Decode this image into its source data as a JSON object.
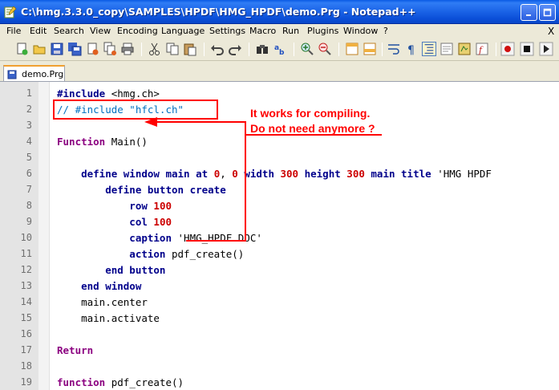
{
  "window": {
    "title": "C:\\hmg.3.3.0_copy\\SAMPLES\\HPDF\\HMG_HPDF\\demo.Prg - Notepad++"
  },
  "menu": {
    "items": [
      "File",
      "Edit",
      "Search",
      "View",
      "Encoding",
      "Language",
      "Settings",
      "Macro",
      "Run",
      "Plugins",
      "Window",
      "?"
    ],
    "close": "X"
  },
  "toolbar": {
    "icons": [
      "new-file-icon",
      "open-file-icon",
      "save-icon",
      "save-all-icon",
      "close-icon",
      "close-all-icon",
      "print-icon",
      "cut-icon",
      "copy-icon",
      "paste-icon",
      "undo-icon",
      "redo-icon",
      "find-icon",
      "replace-icon",
      "zoom-in-icon",
      "zoom-out-icon",
      "sync-v-icon",
      "sync-h-icon",
      "word-wrap-icon",
      "show-all-chars-icon",
      "indent-guide-icon",
      "udl-icon",
      "doc-map-icon",
      "function-list-icon",
      "record-macro-icon",
      "stop-macro-icon",
      "play-macro-icon"
    ]
  },
  "tab": {
    "label": "demo.Prg"
  },
  "editor": {
    "lines": [
      {
        "n": "1",
        "tokens": [
          {
            "t": "#include",
            "c": "kw"
          },
          {
            "t": " <hmg.ch>",
            "c": "plain"
          }
        ]
      },
      {
        "n": "2",
        "tokens": [
          {
            "t": "// #include \"hfcl.ch\"",
            "c": "cmt"
          }
        ]
      },
      {
        "n": "3",
        "tokens": []
      },
      {
        "n": "4",
        "tokens": [
          {
            "t": "Function",
            "c": "kw2"
          },
          {
            "t": " Main()",
            "c": "plain"
          }
        ]
      },
      {
        "n": "5",
        "tokens": []
      },
      {
        "n": "6",
        "tokens": [
          {
            "t": "    define window ",
            "c": "kw"
          },
          {
            "t": "main",
            "c": "kw"
          },
          {
            "t": " at ",
            "c": "kw"
          },
          {
            "t": "0",
            "c": "num"
          },
          {
            "t": ", ",
            "c": "plain"
          },
          {
            "t": "0",
            "c": "num"
          },
          {
            "t": " width ",
            "c": "kw"
          },
          {
            "t": "300",
            "c": "num"
          },
          {
            "t": " height ",
            "c": "kw"
          },
          {
            "t": "300",
            "c": "num"
          },
          {
            "t": " main title ",
            "c": "kw"
          },
          {
            "t": "'HMG HPDF",
            "c": "plain"
          }
        ]
      },
      {
        "n": "7",
        "tokens": [
          {
            "t": "        define button ",
            "c": "kw"
          },
          {
            "t": "create",
            "c": "kw"
          }
        ]
      },
      {
        "n": "8",
        "tokens": [
          {
            "t": "            row ",
            "c": "kw"
          },
          {
            "t": "100",
            "c": "num"
          }
        ]
      },
      {
        "n": "9",
        "tokens": [
          {
            "t": "            col ",
            "c": "kw"
          },
          {
            "t": "100",
            "c": "num"
          }
        ]
      },
      {
        "n": "10",
        "tokens": [
          {
            "t": "            caption ",
            "c": "kw"
          },
          {
            "t": "'HMG_HPDF DOC'",
            "c": "plain"
          }
        ]
      },
      {
        "n": "11",
        "tokens": [
          {
            "t": "            action ",
            "c": "kw"
          },
          {
            "t": "pdf_create()",
            "c": "plain"
          }
        ]
      },
      {
        "n": "12",
        "tokens": [
          {
            "t": "        end button",
            "c": "kw"
          }
        ]
      },
      {
        "n": "13",
        "tokens": [
          {
            "t": "    end window",
            "c": "kw"
          }
        ]
      },
      {
        "n": "14",
        "tokens": [
          {
            "t": "    main.center",
            "c": "plain"
          }
        ]
      },
      {
        "n": "15",
        "tokens": [
          {
            "t": "    main.activate",
            "c": "plain"
          }
        ]
      },
      {
        "n": "16",
        "tokens": []
      },
      {
        "n": "17",
        "tokens": [
          {
            "t": "Return",
            "c": "kw2"
          }
        ]
      },
      {
        "n": "18",
        "tokens": []
      },
      {
        "n": "19",
        "tokens": [
          {
            "t": "function",
            "c": "kw2"
          },
          {
            "t": " pdf_create()",
            "c": "plain"
          }
        ]
      }
    ]
  },
  "annotation": {
    "line1": "It works for compiling.",
    "line2": "Do not need anymore ?",
    "color": "#ff0000"
  }
}
